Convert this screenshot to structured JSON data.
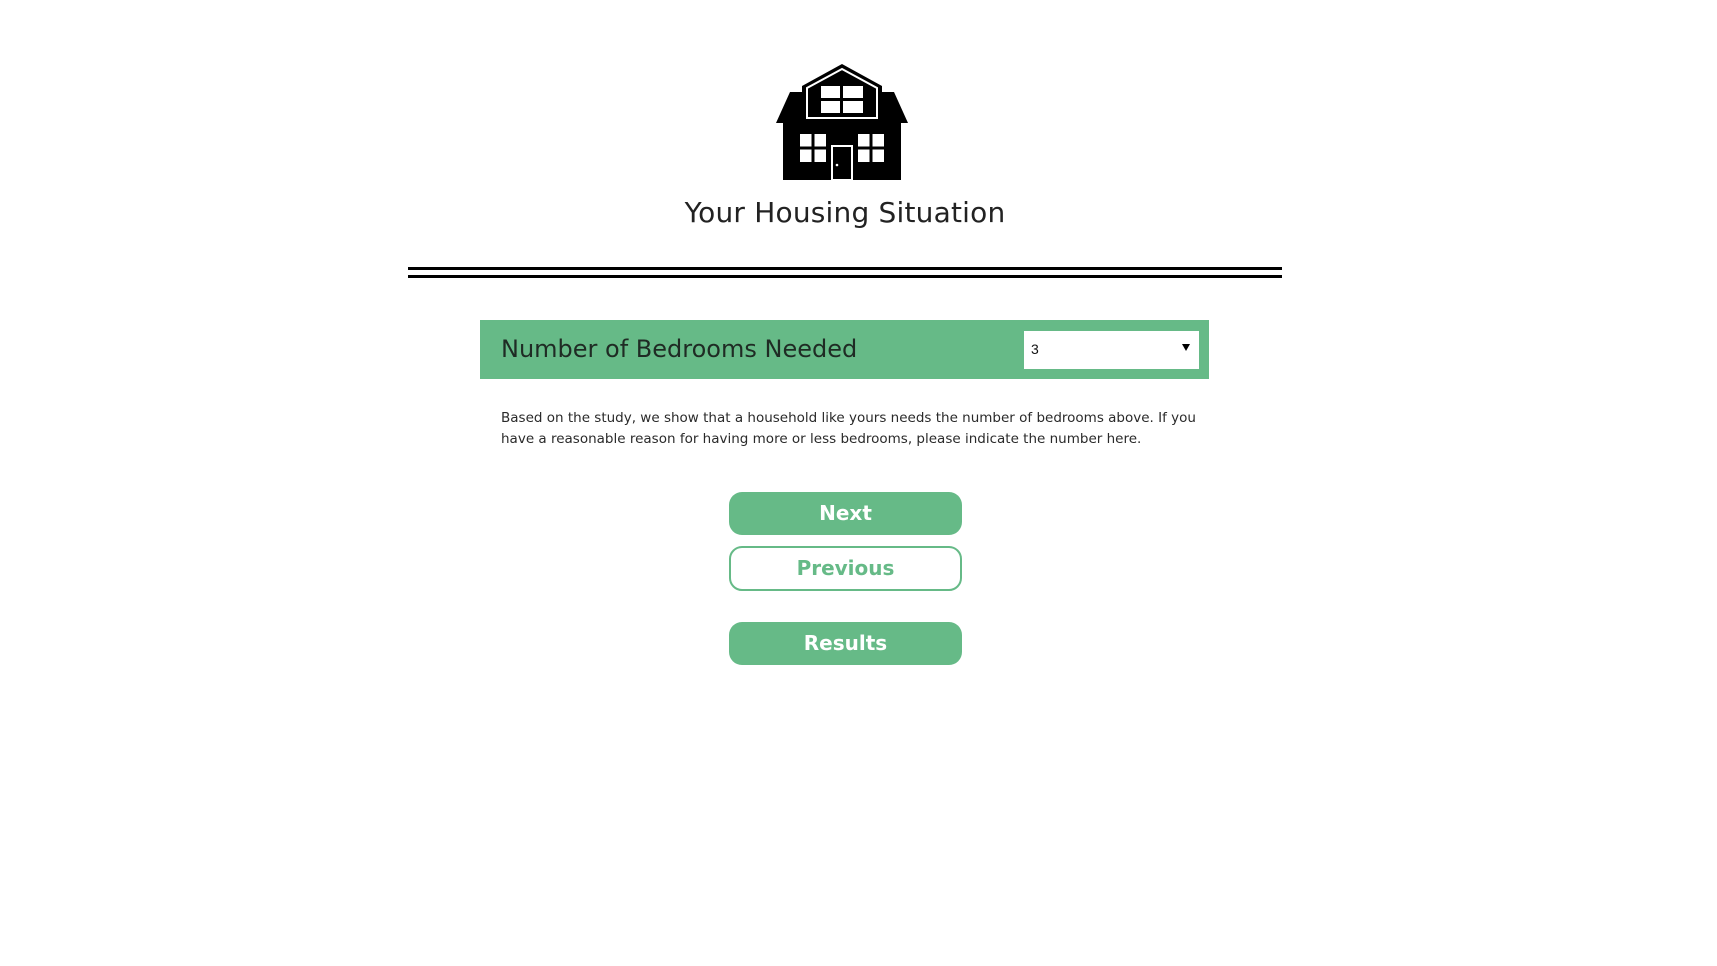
{
  "header": {
    "icon": "house-icon",
    "title": "Your Housing Situation"
  },
  "question": {
    "label": "Number of Bedrooms Needed",
    "select_value": "3",
    "description": "Based on the study, we show that a household like yours needs the number of bedrooms above. If you have a reasonable reason for having more or less bedrooms, please indicate the number here."
  },
  "actions": {
    "next_label": "Next",
    "previous_label": "Previous",
    "results_label": "Results"
  },
  "colors": {
    "accent": "#66ba87",
    "text": "#222222",
    "divider": "#000000"
  }
}
